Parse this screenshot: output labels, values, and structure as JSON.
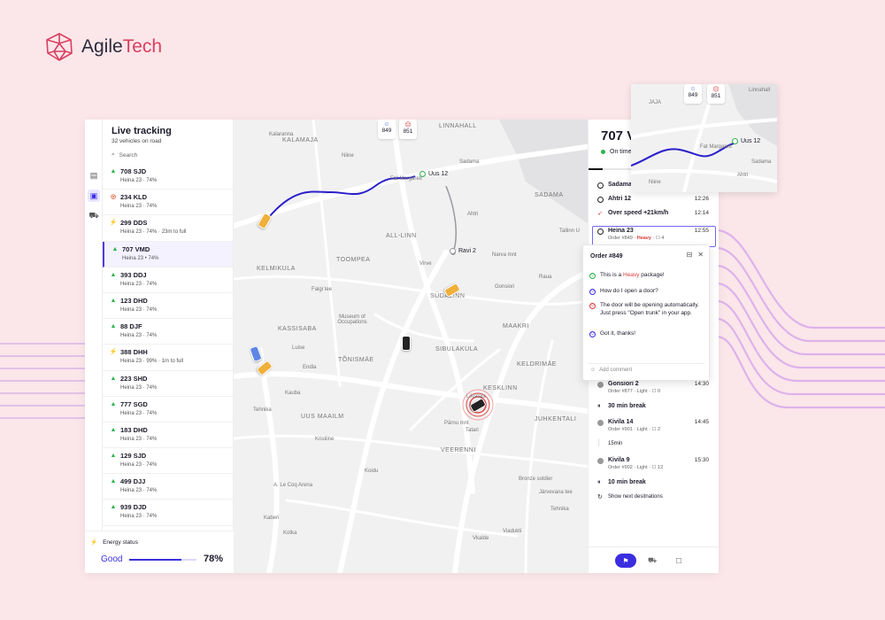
{
  "brand": {
    "name_a": "Agile",
    "name_b": "Tech",
    "logo_icon": "geodesic-sphere-icon"
  },
  "sidebar_rail": {
    "items": [
      {
        "icon": "document-icon"
      },
      {
        "icon": "map-book-icon",
        "active": true
      },
      {
        "icon": "truck-icon"
      }
    ]
  },
  "vehicles": {
    "title": "Live tracking",
    "subtitle": "32 vehicles on road",
    "search_placeholder": "Search",
    "items": [
      {
        "plate": "708 SJD",
        "meta": "Heina 23 · 74%",
        "status": "ok"
      },
      {
        "plate": "234 KLD",
        "meta": "Heina 23 · 74%",
        "status": "alert"
      },
      {
        "plate": "299 DDS",
        "meta": "Heina 23 · 74% · 23m to full",
        "status": "charging"
      },
      {
        "plate": "707 VMD",
        "meta": "Heina 23 • 74%",
        "status": "ok",
        "selected": true
      },
      {
        "plate": "393 DDJ",
        "meta": "Heina 23 · 74%",
        "status": "ok"
      },
      {
        "plate": "123 DHD",
        "meta": "Heina 23 · 74%",
        "status": "ok"
      },
      {
        "plate": "88 DJF",
        "meta": "Heina 23 · 74%",
        "status": "ok"
      },
      {
        "plate": "388 DHH",
        "meta": "Heina 23 · 99% · 1m to full",
        "status": "charging"
      },
      {
        "plate": "223 SHD",
        "meta": "Heina 23 · 74%",
        "status": "ok"
      },
      {
        "plate": "777 SGD",
        "meta": "Heina 23 · 74%",
        "status": "ok"
      },
      {
        "plate": "183 DHD",
        "meta": "Heina 23 · 74%",
        "status": "ok"
      },
      {
        "plate": "129 SJD",
        "meta": "Heina 23 · 74%",
        "status": "ok"
      },
      {
        "plate": "499 DJJ",
        "meta": "Heina 23 · 74%",
        "status": "ok"
      },
      {
        "plate": "939 DJD",
        "meta": "Heina 23 · 74%",
        "status": "ok"
      }
    ]
  },
  "energy": {
    "label": "Energy status",
    "value_text": "Good",
    "percent_text": "78%",
    "level": 0.78,
    "icon": "lightning-icon"
  },
  "map": {
    "badges": [
      {
        "icon": "smile-icon",
        "count": "849",
        "color": "#4a5bd6"
      },
      {
        "icon": "frown-icon",
        "count": "851",
        "color": "#d93b3b"
      }
    ],
    "districts": [
      "KALAMAJA",
      "LINNAHALL",
      "SADAMA",
      "ALL-LINN",
      "KELMIKULA",
      "TOOMPEA",
      "SÜDALINN",
      "KASSISABA",
      "TÕNISMÄE",
      "SIBULAKULA",
      "MAAKRI",
      "KELDRIMÄE",
      "KESKLINN",
      "UUS MAAILM",
      "JUHKENTALI",
      "VEERENNI"
    ],
    "streets": [
      "Kalaranna",
      "Niine",
      "Sadama",
      "Fat Margareti",
      "Ahtri",
      "Narva mnt",
      "Virve",
      "Falgi tee",
      "Gonsiori",
      "Raua",
      "Luise",
      "Endla",
      "Kauba",
      "Tehnika",
      "Liivalaia",
      "Tatari",
      "Pärnu mnt",
      "Kristiine",
      "Koidu",
      "A. Le Coq Arena",
      "Bronze soldier",
      "Tehnika",
      "Vkalde",
      "Kaberi",
      "Tuukri",
      "Tallinn U",
      "Järvevana tee",
      "Museum of Occupations",
      "Viadukti",
      "Kotka"
    ],
    "stops": [
      {
        "name": "Uus 12"
      },
      {
        "name": "Ravi 2"
      }
    ],
    "route_color": "#2a1fc9"
  },
  "panel": {
    "vehicle": "707 VMD",
    "status": "On time",
    "timeline": [
      {
        "title": "Sadama 4",
        "time": "",
        "icon": "circle"
      },
      {
        "title": "Ahtri 12",
        "time": "12:26",
        "icon": "circle"
      },
      {
        "title": "Over speed +21km/h",
        "time": "12:14",
        "icon": "rocket"
      },
      {
        "title": "Heina 23",
        "time": "12:55",
        "order": "Order #849",
        "weight": "Heavy",
        "comments": "4",
        "icon": "circle",
        "highlight": true
      },
      {
        "title": "Gonsiori 2",
        "time": "14:30",
        "order": "Order #877",
        "weight": "Light",
        "comments": "0",
        "icon": "filled"
      },
      {
        "title": "30 min break",
        "time": "",
        "icon": "pause"
      },
      {
        "title": "Kivila 14",
        "time": "14:45",
        "order": "Order #901",
        "weight": "Light",
        "comments": "2",
        "icon": "filled"
      },
      {
        "title": "15min",
        "time": "",
        "icon": "gap"
      },
      {
        "title": "Kivila 9",
        "time": "15:30",
        "order": "Order #902",
        "weight": "Light",
        "comments": "12",
        "icon": "filled"
      },
      {
        "title": "10 min break",
        "time": "",
        "icon": "pause"
      },
      {
        "title": "Show next desitnations",
        "time": "",
        "icon": "refresh"
      }
    ],
    "bottom_tabs": [
      {
        "icon": "flag-icon",
        "active": true
      },
      {
        "icon": "truck-icon"
      },
      {
        "icon": "chat-icon"
      }
    ]
  },
  "chat": {
    "title": "Order #849",
    "messages": [
      {
        "who": "driver",
        "pre": "This is a ",
        "hl": "Heavy",
        "post": " package!",
        "color": "#2db24b"
      },
      {
        "who": "customer",
        "pre": "How do I open a door?",
        "hl": "",
        "post": "",
        "color": "#3b2ee0"
      },
      {
        "who": "driver",
        "pre": "The door will be opening automatically. Just press \"Open trunk\" in your app.",
        "hl": "",
        "post": "",
        "color": "#d93b3b"
      },
      {
        "who": "customer",
        "pre": "Got it, thanks!",
        "hl": "",
        "post": "",
        "color": "#3b2ee0"
      }
    ],
    "input_placeholder": "Add comment"
  },
  "inset": {
    "badges": [
      {
        "count": "849"
      },
      {
        "count": "851"
      }
    ],
    "labels": [
      "Linnahall",
      "JAJA",
      "Fat Margareti",
      "Uus 12",
      "Sadama",
      "Ahtri",
      "Niine"
    ]
  }
}
